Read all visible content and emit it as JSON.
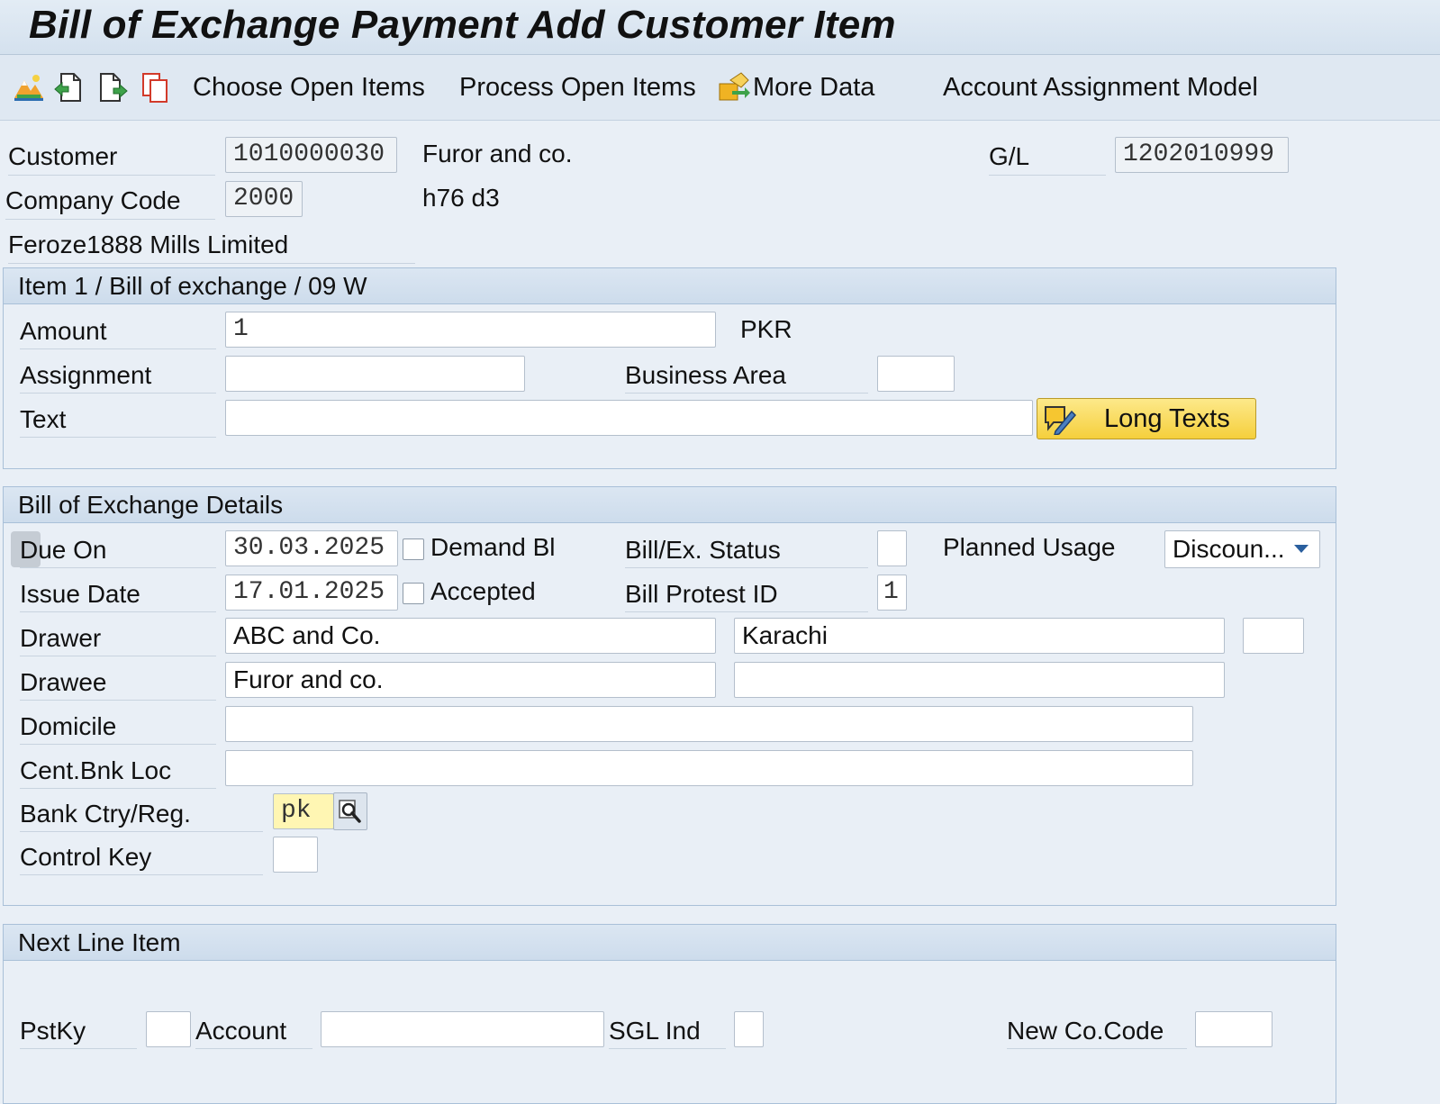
{
  "title": "Bill of Exchange Payment Add Customer Item",
  "toolbar": {
    "icons": [
      "mountain-chart-icon",
      "document-refresh-icon",
      "document-forward-icon",
      "copy-document-icon"
    ],
    "choose_open_items": "Choose Open Items",
    "process_open_items": "Process Open Items",
    "more_data": "More Data",
    "account_assignment_model": "Account Assignment Model"
  },
  "header": {
    "customer_label": "Customer",
    "customer_value": "1010000030",
    "customer_name": "Furor and co.",
    "gl_label": "G/L",
    "gl_value": "1202010999",
    "company_code_label": "Company Code",
    "company_code_value": "2000",
    "company_city": "h76 d3",
    "company_name": "Feroze1888 Mills Limited"
  },
  "item_group": {
    "title": "Item 1 / Bill of exchange / 09 W",
    "amount_label": "Amount",
    "amount_value": "1",
    "currency": "PKR",
    "assignment_label": "Assignment",
    "assignment_value": "",
    "business_area_label": "Business Area",
    "business_area_value": "",
    "text_label": "Text",
    "text_value": "",
    "long_texts_label": "Long Texts"
  },
  "boe_details": {
    "title": "Bill of Exchange Details",
    "due_on_label": "Due On",
    "due_on_value": "30.03.2025",
    "demand_bill_label": "Demand Bl",
    "bill_status_label": "Bill/Ex. Status",
    "bill_status_value": "",
    "planned_usage_label": "Planned Usage",
    "planned_usage_value": "Discoun...",
    "issue_date_label": "Issue Date",
    "issue_date_value": "17.01.2025",
    "accepted_label": "Accepted",
    "bill_protest_label": "Bill Protest ID",
    "bill_protest_value": "1",
    "drawer_label": "Drawer",
    "drawer_name": "ABC and Co.",
    "drawer_city": "Karachi",
    "drawer_extra": "",
    "drawee_label": "Drawee",
    "drawee_name": "Furor and co.",
    "drawee_city": "",
    "domicile_label": "Domicile",
    "domicile_value": "",
    "central_bank_label": "Cent.Bnk Loc",
    "central_bank_value": "",
    "bank_country_label": "Bank Ctry/Reg.",
    "bank_country_value": "pk",
    "control_key_label": "Control Key",
    "control_key_value": ""
  },
  "next_line": {
    "title": "Next Line Item",
    "pstky_label": "PstKy",
    "pstky_value": "",
    "account_label": "Account",
    "account_value": "",
    "sgl_label": "SGL Ind",
    "sgl_value": "",
    "new_cocode_label": "New Co.Code",
    "new_cocode_value": ""
  }
}
